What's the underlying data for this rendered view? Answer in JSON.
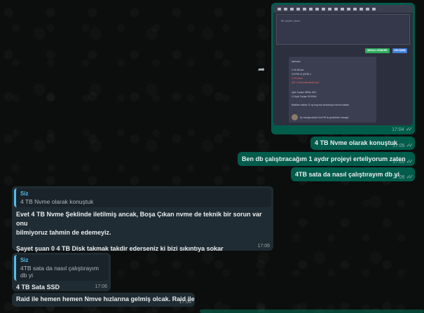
{
  "image_message": {
    "time": "17:04",
    "editor_placeholder": "Bir şeyler yazın",
    "button_green": "MESAJ GÖNDER",
    "button_blue": "GELİŞMİŞ",
    "card_lines": [
      "Merhaba",
      "2 Gb 88 tam",
      "20 IPMI GI (DDR) 4",
      "4 TB Nvme",
      "200 1 Gbit kullanılabilir ipvd",
      "Aylık Toplam 9999₺ KDV",
      "12 Aylık Toplam 99.999₺*",
      "Belirtilen takibte 12 ay boyunca kiralamaya hizmeti sabittir."
    ],
    "card_footer": "Şu mesajınızdaki Hızlı PM ile görüntülen mesajdı."
  },
  "messages": {
    "m1": {
      "text": "4 TB Nvme olarak konuştuk",
      "time": "17:05"
    },
    "m2": {
      "text": "Ben db çalıştıracağım 1 aydır projeyi erteliyorum zaten",
      "time": "17:05"
    },
    "m3": {
      "text": "4TB sata da nasıl çalıştırayım db yi",
      "time": "17:06"
    },
    "m4": {
      "reply_name": "Siz",
      "reply_text": "4 TB Nvme olarak konuştuk",
      "line1": "Evet 4 TB Nvme Şeklinde iletilmiş ancak, Boşa Çıkan nvme de teknik bir sorun var onu",
      "line2": "bilmiyoruz tahmin de edemeyiz.",
      "line3": "Şayet şuan 0 4 TB Disk takmak takdir ederseniz ki bizi sıkıntıya sokar",
      "time": "17:06"
    },
    "m5": {
      "reply_name": "Siz",
      "reply_text": "4TB sata da nasıl çalıştırayım db yi",
      "text": "4 TB Sata SSD",
      "time": "17:06"
    },
    "m6": {
      "text": "Raid ile hemen hemen Nmve hızlarına gelmiş olcak. Raid ile",
      "time": "17:06"
    }
  },
  "tick_glyph": "✓✓"
}
